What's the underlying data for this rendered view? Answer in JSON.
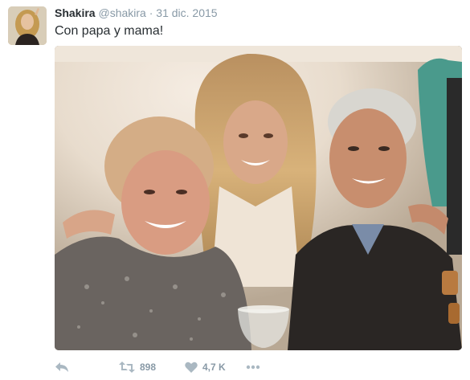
{
  "tweet": {
    "author_name": "Shakira",
    "author_handle": "@shakira",
    "separator": "·",
    "date": "31 dic. 2015",
    "text": "Con papa y mama!",
    "retweet_count": "898",
    "like_count": "4,7 K"
  },
  "actions": {
    "reply_icon": "reply-icon",
    "retweet_icon": "retweet-icon",
    "like_icon": "heart-icon",
    "more_icon": "more-icon"
  },
  "colors": {
    "text": "#292f33",
    "muted": "#8899a6",
    "background": "#ffffff"
  }
}
